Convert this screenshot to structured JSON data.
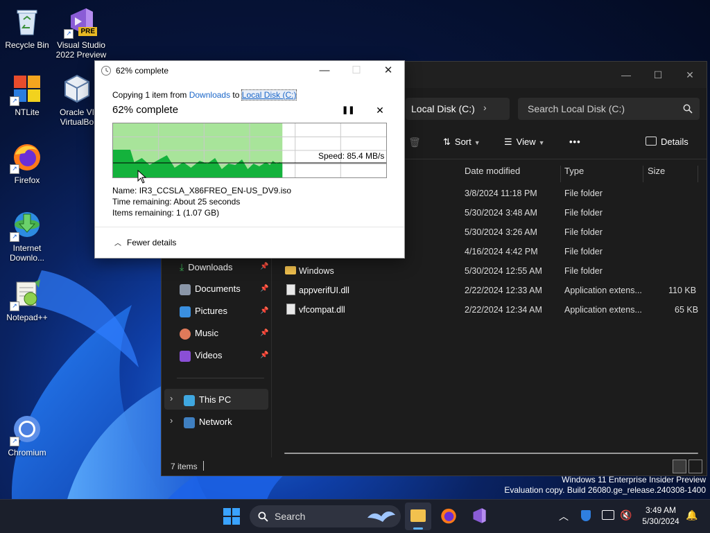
{
  "desktop": {
    "icons": [
      {
        "label": "Recycle Bin"
      },
      {
        "label": "Visual Studio 2022 Preview",
        "badge": "PRE"
      },
      {
        "label": "NTLite"
      },
      {
        "label": "Oracle VM VirtualBox",
        "display": "Oracle VI VirtualBo"
      },
      {
        "label": "Firefox"
      },
      {
        "label": "Internet Downlo..."
      },
      {
        "label": "Notepad++"
      },
      {
        "label": "Chromium"
      }
    ],
    "watermark": {
      "line1": "Windows 11 Enterprise Insider Preview",
      "line2": "Evaluation copy. Build 26080.ge_release.240308-1400"
    }
  },
  "copy_dialog": {
    "title": "62% complete",
    "copying_prefix": "Copying 1 item from ",
    "source": "Downloads",
    "to_word": " to ",
    "destination": "Local Disk (C:)",
    "heading": "62% complete",
    "progress_percent": 62,
    "speed": "Speed: 85.4 MB/s",
    "name_label": "Name:",
    "name_value": "IR3_CCSLA_X86FREO_EN-US_DV9.iso",
    "time_label": "Time remaining:",
    "time_value": "About 25 seconds",
    "items_label": "Items remaining:",
    "items_value": "1 (1.07 GB)",
    "fewer_details": "Fewer details",
    "accent_fill": "#a8e49a",
    "accent_area": "#14b23c"
  },
  "explorer": {
    "address_crumb": "Local Disk (C:)",
    "search_placeholder": "Search Local Disk (C:)",
    "toolbar": {
      "sort": "Sort",
      "view": "View",
      "more": "•••",
      "details": "Details"
    },
    "nav": [
      {
        "label": "Downloads",
        "pinned": true
      },
      {
        "label": "Documents",
        "pinned": true
      },
      {
        "label": "Pictures",
        "pinned": true
      },
      {
        "label": "Music",
        "pinned": true
      },
      {
        "label": "Videos",
        "pinned": true
      },
      {
        "label": "This PC",
        "pinned": false
      },
      {
        "label": "Network",
        "pinned": false
      }
    ],
    "columns": {
      "date": "Date modified",
      "type": "Type",
      "size": "Size"
    },
    "rows": [
      {
        "name": "",
        "date": "3/8/2024 11:18 PM",
        "type": "File folder",
        "size": ""
      },
      {
        "name": "",
        "date": "5/30/2024 3:48 AM",
        "type": "File folder",
        "size": ""
      },
      {
        "name": "",
        "date": "5/30/2024 3:26 AM",
        "type": "File folder",
        "size": ""
      },
      {
        "name": "",
        "date": "4/16/2024 4:42 PM",
        "type": "File folder",
        "size": ""
      },
      {
        "name": "Windows",
        "date": "5/30/2024 12:55 AM",
        "type": "File folder",
        "size": ""
      },
      {
        "name": "appverifUI.dll",
        "date": "2/22/2024 12:33 AM",
        "type": "Application extens...",
        "size": "110 KB"
      },
      {
        "name": "vfcompat.dll",
        "date": "2/22/2024 12:34 AM",
        "type": "Application extens...",
        "size": "65 KB"
      }
    ],
    "status": "7 items"
  },
  "taskbar": {
    "search_label": "Search",
    "time": "3:49 AM",
    "date": "5/30/2024"
  }
}
